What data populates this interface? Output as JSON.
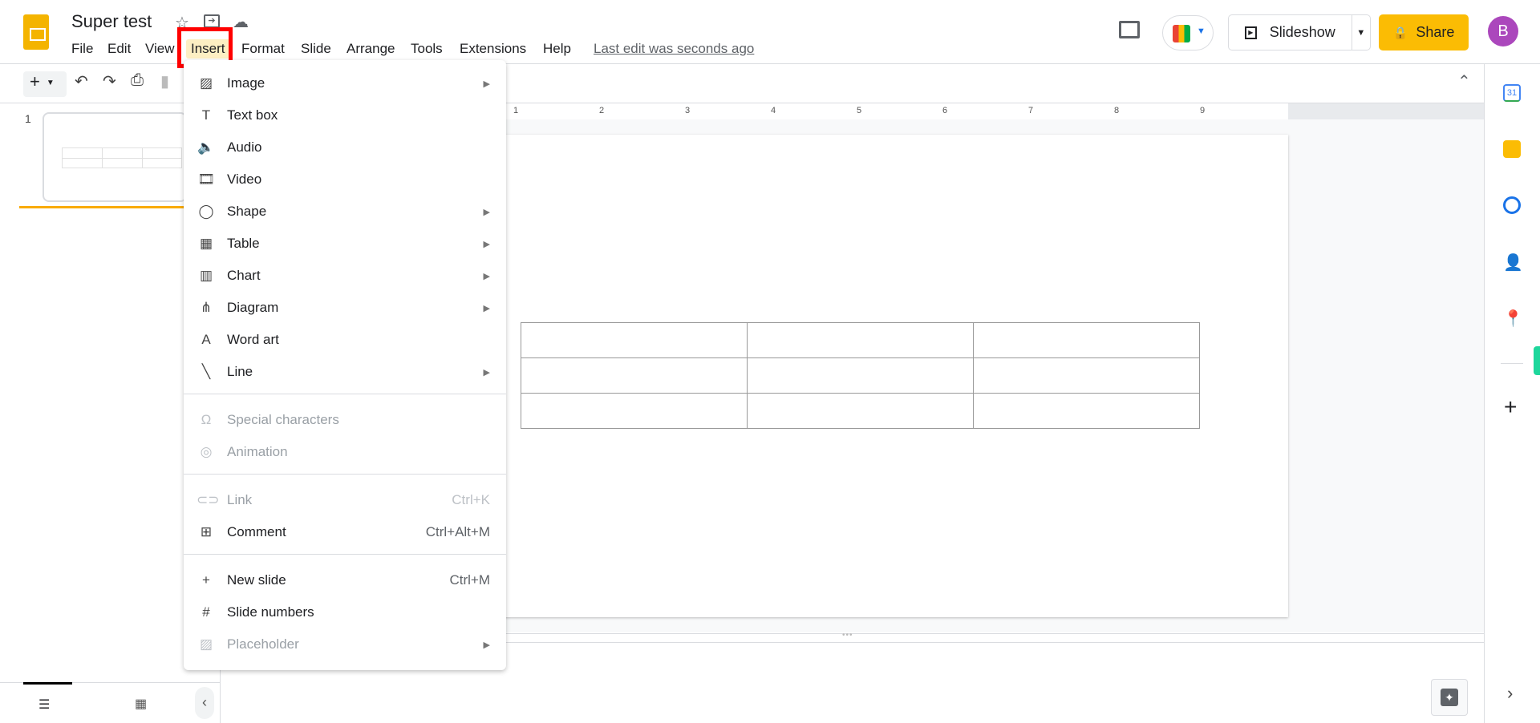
{
  "app": {
    "title": "Super test",
    "last_edit": "Last edit was seconds ago",
    "brand_color": "#f4b400"
  },
  "menubar": [
    {
      "label": "File"
    },
    {
      "label": "Edit"
    },
    {
      "label": "View"
    },
    {
      "label": "Insert"
    },
    {
      "label": "Format"
    },
    {
      "label": "Slide"
    },
    {
      "label": "Arrange"
    },
    {
      "label": "Tools"
    },
    {
      "label": "Extensions"
    },
    {
      "label": "Help"
    }
  ],
  "header": {
    "slideshow": "Slideshow",
    "share": "Share",
    "avatar": "B",
    "share_color": "#fbbc04",
    "avatar_color": "#ab47bc"
  },
  "filmstrip": {
    "slide_number": "1"
  },
  "ruler": [
    "1",
    "2",
    "3",
    "4",
    "5",
    "6",
    "7",
    "8",
    "9"
  ],
  "insert_menu": {
    "items": [
      {
        "label": "Image",
        "icon": "image-icon",
        "submenu": true
      },
      {
        "label": "Text box",
        "icon": "text-box-icon"
      },
      {
        "label": "Audio",
        "icon": "audio-icon"
      },
      {
        "label": "Video",
        "icon": "video-icon"
      },
      {
        "label": "Shape",
        "icon": "shape-icon",
        "submenu": true
      },
      {
        "label": "Table",
        "icon": "table-icon",
        "submenu": true
      },
      {
        "label": "Chart",
        "icon": "chart-icon",
        "submenu": true
      },
      {
        "label": "Diagram",
        "icon": "diagram-icon",
        "submenu": true
      },
      {
        "label": "Word art",
        "icon": "word-art-icon"
      },
      {
        "label": "Line",
        "icon": "line-icon",
        "submenu": true
      },
      {
        "label": "Special characters",
        "icon": "omega-icon",
        "disabled": true
      },
      {
        "label": "Animation",
        "icon": "animation-icon",
        "disabled": true
      },
      {
        "label": "Link",
        "icon": "link-icon",
        "shortcut": "Ctrl+K",
        "disabled": true
      },
      {
        "label": "Comment",
        "icon": "comment-add-icon",
        "shortcut": "Ctrl+Alt+M"
      },
      {
        "label": "New slide",
        "icon": "plus-icon",
        "shortcut": "Ctrl+M"
      },
      {
        "label": "Slide numbers",
        "icon": "hash-icon"
      },
      {
        "label": "Placeholder",
        "icon": "placeholder-icon",
        "submenu": true,
        "disabled": true
      }
    ]
  }
}
